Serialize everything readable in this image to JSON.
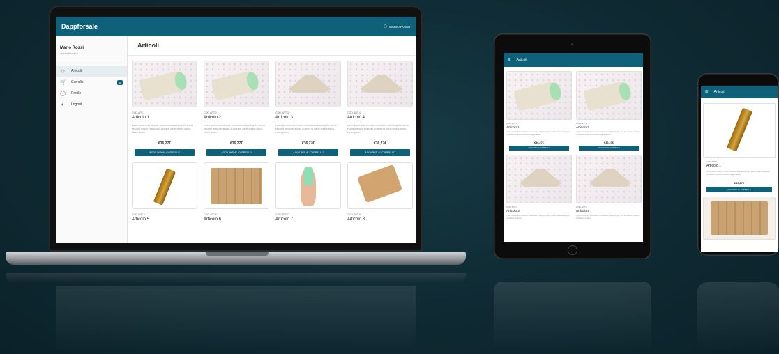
{
  "app": {
    "title": "Dappforsale",
    "user_label": "MARIO ROSSI"
  },
  "sidebar": {
    "user_name": "Mario Rossi",
    "user_email": "mario@rossi.it",
    "items": [
      {
        "label": "Articoli",
        "icon": "tag-icon"
      },
      {
        "label": "Carrello",
        "icon": "cart-icon",
        "badge": "6"
      },
      {
        "label": "Profilo",
        "icon": "person-icon"
      },
      {
        "label": "Logout",
        "icon": "logout-icon"
      }
    ]
  },
  "main": {
    "title": "Articoli",
    "products": [
      {
        "code": "COD.ART.1",
        "title": "Articolo 1",
        "desc": "Lorem ipsum dolor sit amet, consectetur adipiscing elit, sed do eiusmod tempor incididunt ut labore et dolore magna aliqua. Lorem ipsum...",
        "price": "€36,27€",
        "button": "AGGIUNGI AL CARRELLO"
      },
      {
        "code": "COD.ART.2",
        "title": "Articolo 2",
        "desc": "Lorem ipsum dolor sit amet, consectetur adipiscing elit, sed do eiusmod tempor incididunt ut labore et dolore magna aliqua. Lorem ipsum...",
        "price": "€36,27€",
        "button": "AGGIUNGI AL CARRELLO"
      },
      {
        "code": "COD.ART.3",
        "title": "Articolo 3",
        "desc": "Lorem ipsum dolor sit amet, consectetur adipiscing elit, sed do eiusmod tempor incididunt ut labore et dolore magna aliqua. Lorem ipsum...",
        "price": "€36,27€",
        "button": "AGGIUNGI AL CARRELLO"
      },
      {
        "code": "COD.ART.4",
        "title": "Articolo 4",
        "desc": "Lorem ipsum dolor sit amet, consectetur adipiscing elit, sed do eiusmod tempor incididunt ut labore et dolore magna aliqua. Lorem ipsum...",
        "price": "€36,27€",
        "button": "AGGIUNGI AL CARRELLO"
      },
      {
        "code": "COD.ART.5",
        "title": "Articolo 5"
      },
      {
        "code": "COD.ART.6",
        "title": "Articolo 6"
      },
      {
        "code": "COD.ART.7",
        "title": "Articolo 7"
      },
      {
        "code": "COD.ART.8",
        "title": "Articolo 8"
      }
    ]
  },
  "tablet": {
    "header": "Articoli",
    "products": [
      {
        "code": "COD.ART.1",
        "title": "Articolo 1",
        "desc": "Lorem ipsum dolor sit amet, consectetur adipiscing elit, sed do eiusmod tempor incididunt ut labore et dolore magna aliqua.",
        "price": "€36,27€",
        "button": "AGGIUNGI AL CARRELLO"
      },
      {
        "code": "COD.ART.2",
        "title": "Articolo 2",
        "desc": "Lorem ipsum dolor sit amet, consectetur adipiscing elit, sed do eiusmod tempor incididunt ut labore et dolore magna aliqua.",
        "price": "€36,27€",
        "button": "AGGIUNGI AL CARRELLO"
      },
      {
        "code": "COD.ART.3",
        "title": "Articolo 3",
        "desc": "Lorem ipsum dolor sit amet, consectetur adipiscing elit, sed do eiusmod tempor incididunt ut labore."
      },
      {
        "code": "COD.ART.4",
        "title": "Articolo 4",
        "desc": "Lorem ipsum dolor sit amet, consectetur adipiscing elit, sed do eiusmod tempor incididunt ut labore."
      }
    ]
  },
  "phone": {
    "header": "Articoli",
    "product": {
      "code": "COD.ART.1",
      "title": "Articolo 1",
      "desc": "Lorem ipsum dolor sit amet, consectetur adipiscing elit, sed do eiusmod tempor incididunt ut labore et dolore magna aliqua.",
      "price": "€36,27€",
      "button": "AGGIUNGI AL CARRELLO"
    }
  },
  "colors": {
    "primary": "#0f6079",
    "background": "#0f2a33"
  }
}
